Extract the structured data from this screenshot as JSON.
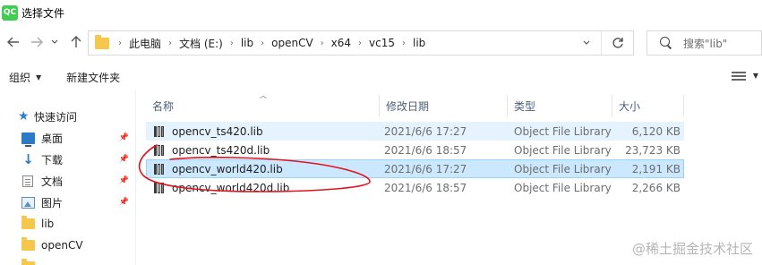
{
  "window": {
    "app_icon": "QC",
    "title": "选择文件"
  },
  "nav": {
    "back_icon": "arrow-left-icon",
    "forward_icon": "arrow-right-icon",
    "recent_icon": "chevron-down-icon",
    "up_icon": "arrow-up-icon"
  },
  "address": {
    "breadcrumb": [
      "此电脑",
      "文档 (E:)",
      "lib",
      "openCV",
      "x64",
      "vc15",
      "lib"
    ],
    "refresh_icon": "refresh-icon"
  },
  "search": {
    "placeholder": "搜索\"lib\""
  },
  "toolbar": {
    "organize_label": "组织",
    "new_folder_label": "新建文件夹"
  },
  "sidebar": {
    "quick_access_label": "快速访问",
    "items": [
      {
        "label": "桌面",
        "icon": "desktop-icon",
        "pinned": true
      },
      {
        "label": "下载",
        "icon": "download-icon",
        "pinned": true
      },
      {
        "label": "文档",
        "icon": "document-icon",
        "pinned": true
      },
      {
        "label": "图片",
        "icon": "picture-icon",
        "pinned": true
      },
      {
        "label": "lib",
        "icon": "folder-icon",
        "pinned": false
      },
      {
        "label": "openCV",
        "icon": "folder-icon",
        "pinned": false
      }
    ]
  },
  "filelist": {
    "columns": [
      "名称",
      "修改日期",
      "类型",
      "大小"
    ],
    "rows": [
      {
        "name": "opencv_ts420.lib",
        "modified": "2021/6/6 17:27",
        "type": "Object File Library",
        "size": "6,120 KB",
        "state": "hover"
      },
      {
        "name": "opencv_ts420d.lib",
        "modified": "2021/6/6 18:57",
        "type": "Object File Library",
        "size": "23,723 KB",
        "state": "normal"
      },
      {
        "name": "opencv_world420.lib",
        "modified": "2021/6/6 17:27",
        "type": "Object File Library",
        "size": "2,191 KB",
        "state": "selected"
      },
      {
        "name": "opencv_world420d.lib",
        "modified": "2021/6/6 18:57",
        "type": "Object File Library",
        "size": "2,266 KB",
        "state": "normal"
      }
    ]
  },
  "annotation": {
    "color": "#e0141e",
    "shape": "hand-drawn circle around opencv_world420.lib"
  },
  "watermark": "@稀土掘金技术社区"
}
